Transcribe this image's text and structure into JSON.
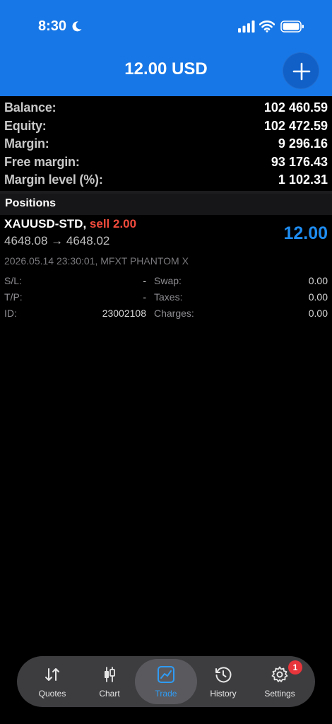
{
  "status_bar": {
    "time": "8:30"
  },
  "header": {
    "title": "12.00 USD"
  },
  "summary": [
    {
      "label": "Balance:",
      "value": "102 460.59"
    },
    {
      "label": "Equity:",
      "value": "102 472.59"
    },
    {
      "label": "Margin:",
      "value": "9 296.16"
    },
    {
      "label": "Free margin:",
      "value": "93 176.43"
    },
    {
      "label": "Margin level (%):",
      "value": "1 102.31"
    }
  ],
  "positions": {
    "title": "Positions",
    "item": {
      "symbol": "XAUUSD-STD,",
      "side": "sell 2.00",
      "prices": "4648.08 → 4648.02",
      "profit": "12.00",
      "opened": "2026.05.14 23:30:01, MFXT PHANTOM X",
      "sl_label": "S/L:",
      "sl_value": "-",
      "tp_label": "T/P:",
      "tp_value": "-",
      "id_label": "ID:",
      "id_value": "23002108",
      "swap_label": "Swap:",
      "swap_value": "0.00",
      "taxes_label": "Taxes:",
      "taxes_value": "0.00",
      "charges_label": "Charges:",
      "charges_value": "0.00"
    }
  },
  "tabbar": {
    "tabs": [
      {
        "label": "Quotes",
        "icon": "quotes-icon"
      },
      {
        "label": "Chart",
        "icon": "candlestick-icon"
      },
      {
        "label": "Trade",
        "icon": "trade-chart-icon",
        "active": true
      },
      {
        "label": "History",
        "icon": "history-icon"
      },
      {
        "label": "Settings",
        "icon": "gear-icon",
        "badge": "1"
      }
    ]
  },
  "colors": {
    "header_bg": "#1877e6",
    "profit": "#1e8cf0",
    "sell": "#f04a3c",
    "badge": "#e8353b",
    "active_tab": "#2f9bf5"
  }
}
